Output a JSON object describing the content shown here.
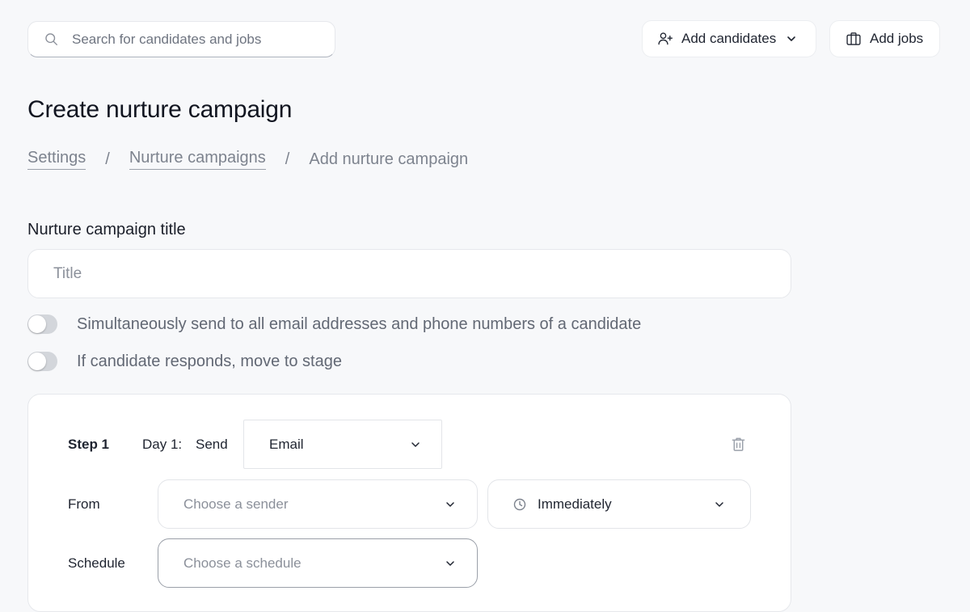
{
  "header": {
    "search_placeholder": "Search for candidates and jobs",
    "add_candidates_label": "Add candidates",
    "add_jobs_label": "Add jobs"
  },
  "page": {
    "title": "Create nurture campaign",
    "breadcrumbs": [
      {
        "label": "Settings"
      },
      {
        "label": "Nurture campaigns"
      },
      {
        "label": "Add nurture campaign"
      }
    ],
    "breadcrumb_separator": "/"
  },
  "form": {
    "title_label": "Nurture campaign title",
    "title_placeholder": "Title",
    "title_value": "",
    "toggles": [
      {
        "label": "Simultaneously send to all email addresses and phone numbers of a candidate",
        "on": false
      },
      {
        "label": "If candidate responds, move to stage",
        "on": false
      }
    ]
  },
  "step": {
    "step_label": "Step 1",
    "day_label": "Day 1:",
    "send_label": "Send",
    "channel_value": "Email",
    "from_label": "From",
    "sender_placeholder": "Choose a sender",
    "timing_value": "Immediately",
    "schedule_label": "Schedule",
    "schedule_placeholder": "Choose a schedule"
  },
  "icons": {
    "search": "search-icon",
    "add_user": "user-plus-icon",
    "chevron": "chevron-down-icon",
    "briefcase": "briefcase-icon",
    "trash": "trash-icon",
    "clock": "clock-icon"
  },
  "colors": {
    "background": "#f7f8fa",
    "card": "#ffffff",
    "toggle_off": "#d3d6db",
    "muted_text": "#7d838e"
  }
}
